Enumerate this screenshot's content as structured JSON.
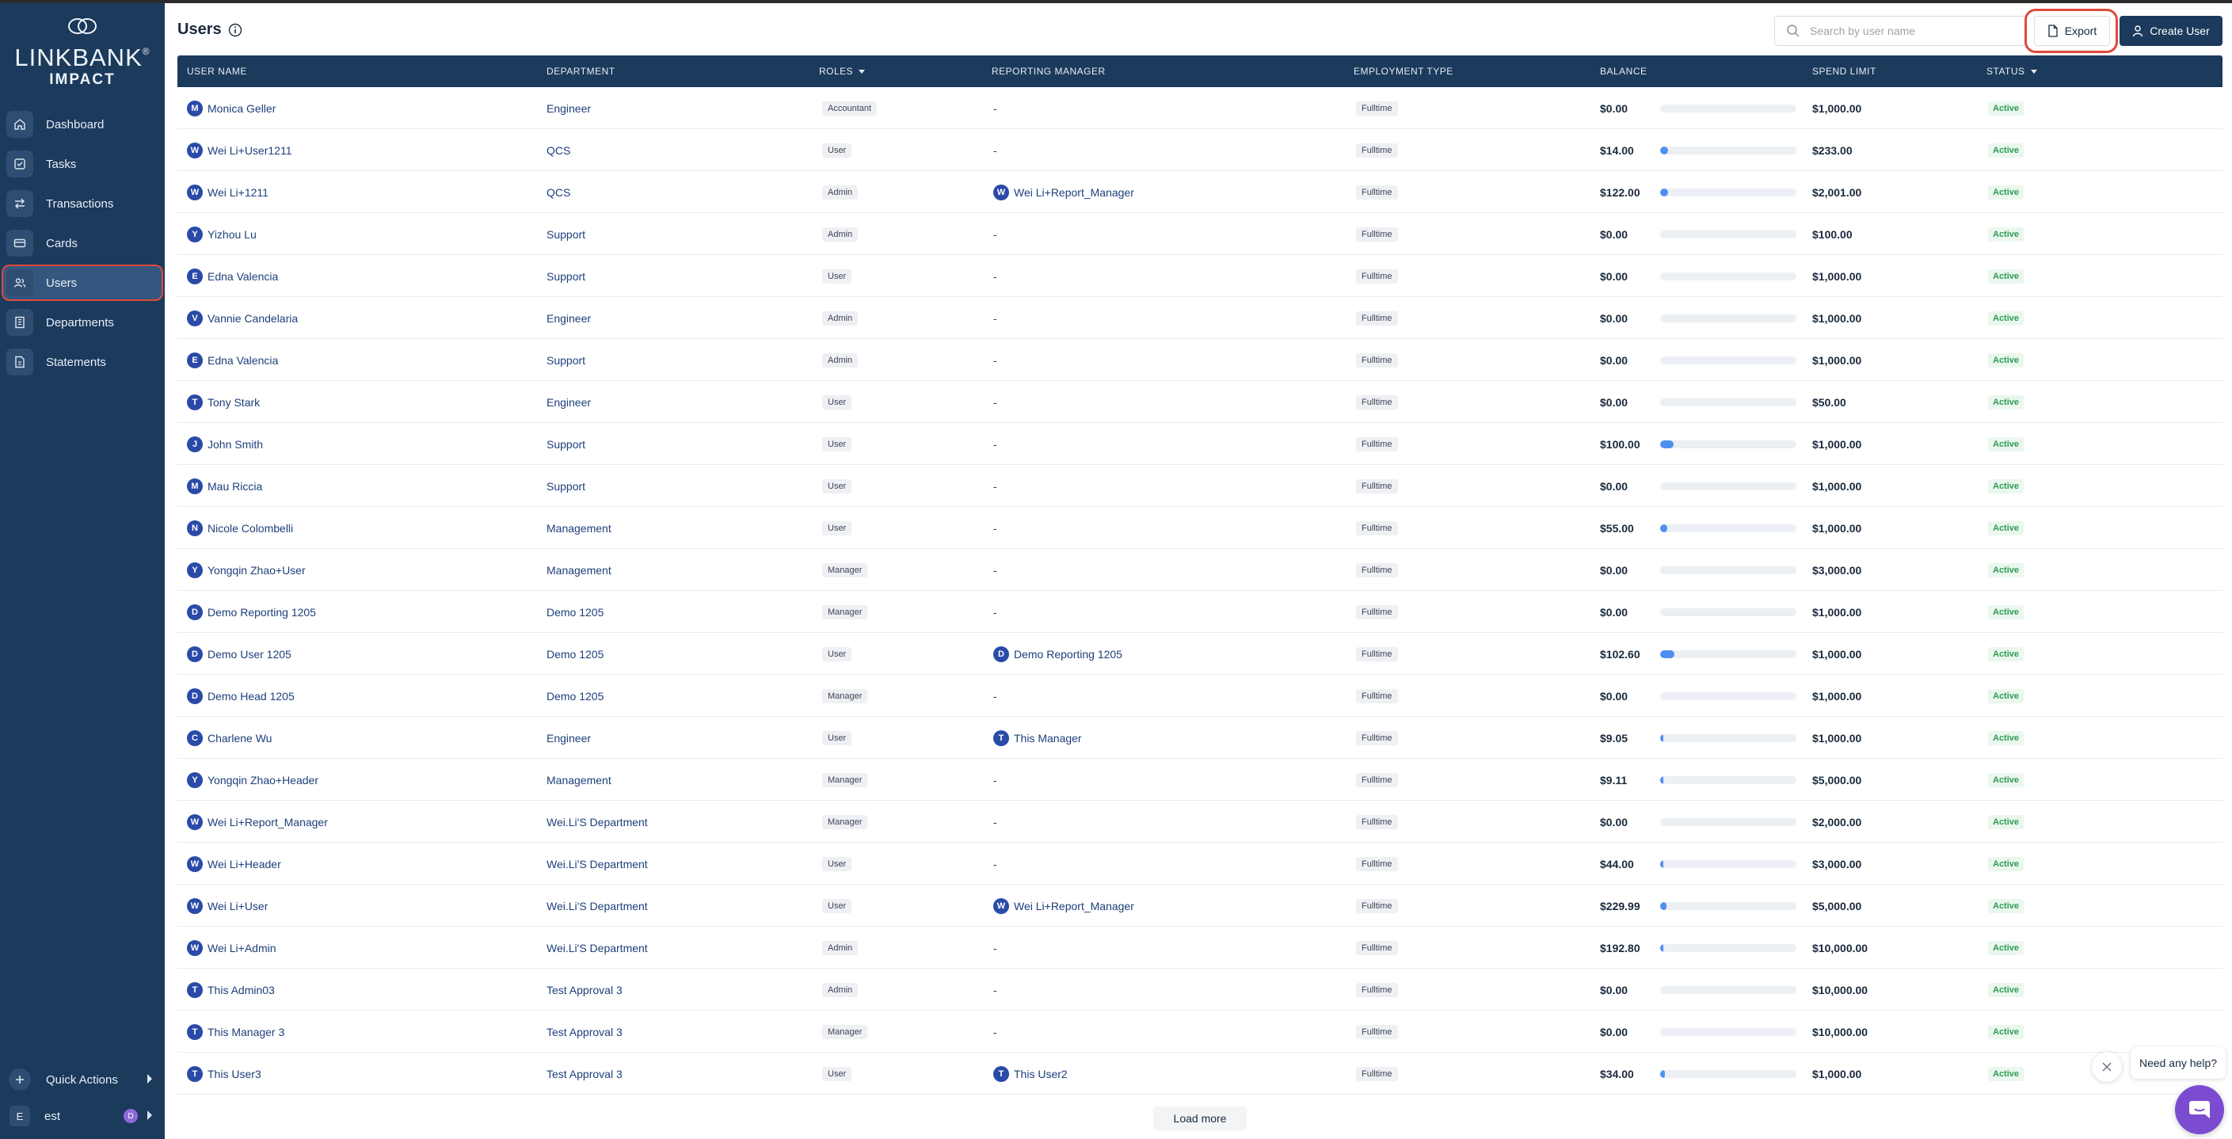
{
  "app": {
    "brand": "LINKBANK",
    "brand_mark": "®",
    "brand_sub": "IMPACT"
  },
  "sidebar": {
    "items": [
      {
        "label": "Dashboard",
        "icon": "home-icon"
      },
      {
        "label": "Tasks",
        "icon": "check-square-icon"
      },
      {
        "label": "Transactions",
        "icon": "arrows-icon"
      },
      {
        "label": "Cards",
        "icon": "card-icon"
      },
      {
        "label": "Users",
        "icon": "users-icon",
        "active": true
      },
      {
        "label": "Departments",
        "icon": "building-icon"
      },
      {
        "label": "Statements",
        "icon": "document-icon"
      }
    ],
    "quick_actions": "Quick Actions",
    "account_initial": "E",
    "account_name": "est",
    "account_avatar": "D"
  },
  "header": {
    "title": "Users",
    "search_placeholder": "Search by user name",
    "export_label": "Export",
    "create_label": "Create User"
  },
  "table": {
    "columns": [
      "USER NAME",
      "DEPARTMENT",
      "ROLES",
      "REPORTING MANAGER",
      "EMPLOYMENT TYPE",
      "BALANCE",
      "SPEND LIMIT",
      "STATUS"
    ],
    "rows": [
      {
        "initial": "M",
        "name": "Monica Geller",
        "dept": "Engineer",
        "role": "Accountant",
        "mgr": "-",
        "mgr_initial": "",
        "emp": "Fulltime",
        "balance": "$0.00",
        "bar": 0,
        "limit": "$1,000.00",
        "status": "Active"
      },
      {
        "initial": "W",
        "name": "Wei Li+User1211",
        "dept": "QCS",
        "role": "User",
        "mgr": "-",
        "mgr_initial": "",
        "emp": "Fulltime",
        "balance": "$14.00",
        "bar": 0.06,
        "limit": "$233.00",
        "status": "Active"
      },
      {
        "initial": "W",
        "name": "Wei Li+1211",
        "dept": "QCS",
        "role": "Admin",
        "mgr": "Wei Li+Report_Manager",
        "mgr_initial": "W",
        "emp": "Fulltime",
        "balance": "$122.00",
        "bar": 0.06,
        "limit": "$2,001.00",
        "status": "Active"
      },
      {
        "initial": "Y",
        "name": "Yizhou Lu",
        "dept": "Support",
        "role": "Admin",
        "mgr": "-",
        "mgr_initial": "",
        "emp": "Fulltime",
        "balance": "$0.00",
        "bar": 0,
        "limit": "$100.00",
        "status": "Active"
      },
      {
        "initial": "E",
        "name": "Edna Valencia",
        "dept": "Support",
        "role": "User",
        "mgr": "-",
        "mgr_initial": "",
        "emp": "Fulltime",
        "balance": "$0.00",
        "bar": 0,
        "limit": "$1,000.00",
        "status": "Active"
      },
      {
        "initial": "V",
        "name": "Vannie Candelaria",
        "dept": "Engineer",
        "role": "Admin",
        "mgr": "-",
        "mgr_initial": "",
        "emp": "Fulltime",
        "balance": "$0.00",
        "bar": 0,
        "limit": "$1,000.00",
        "status": "Active"
      },
      {
        "initial": "E",
        "name": "Edna Valencia",
        "dept": "Support",
        "role": "Admin",
        "mgr": "-",
        "mgr_initial": "",
        "emp": "Fulltime",
        "balance": "$0.00",
        "bar": 0,
        "limit": "$1,000.00",
        "status": "Active"
      },
      {
        "initial": "T",
        "name": "Tony Stark",
        "dept": "Engineer",
        "role": "User",
        "mgr": "-",
        "mgr_initial": "",
        "emp": "Fulltime",
        "balance": "$0.00",
        "bar": 0,
        "limit": "$50.00",
        "status": "Active"
      },
      {
        "initial": "J",
        "name": "John Smith",
        "dept": "Support",
        "role": "User",
        "mgr": "-",
        "mgr_initial": "",
        "emp": "Fulltime",
        "balance": "$100.00",
        "bar": 0.1,
        "limit": "$1,000.00",
        "status": "Active"
      },
      {
        "initial": "M",
        "name": "Mau Riccia",
        "dept": "Support",
        "role": "User",
        "mgr": "-",
        "mgr_initial": "",
        "emp": "Fulltime",
        "balance": "$0.00",
        "bar": 0,
        "limit": "$1,000.00",
        "status": "Active"
      },
      {
        "initial": "N",
        "name": "Nicole Colombelli",
        "dept": "Management",
        "role": "User",
        "mgr": "-",
        "mgr_initial": "",
        "emp": "Fulltime",
        "balance": "$55.00",
        "bar": 0.055,
        "limit": "$1,000.00",
        "status": "Active"
      },
      {
        "initial": "Y",
        "name": "Yongqin Zhao+User",
        "dept": "Management",
        "role": "Manager",
        "mgr": "-",
        "mgr_initial": "",
        "emp": "Fulltime",
        "balance": "$0.00",
        "bar": 0,
        "limit": "$3,000.00",
        "status": "Active"
      },
      {
        "initial": "D",
        "name": "Demo Reporting 1205",
        "dept": "Demo 1205",
        "role": "Manager",
        "mgr": "-",
        "mgr_initial": "",
        "emp": "Fulltime",
        "balance": "$0.00",
        "bar": 0,
        "limit": "$1,000.00",
        "status": "Active"
      },
      {
        "initial": "D",
        "name": "Demo User 1205",
        "dept": "Demo 1205",
        "role": "User",
        "mgr": "Demo Reporting 1205",
        "mgr_initial": "D",
        "emp": "Fulltime",
        "balance": "$102.60",
        "bar": 0.103,
        "limit": "$1,000.00",
        "status": "Active"
      },
      {
        "initial": "D",
        "name": "Demo Head 1205",
        "dept": "Demo 1205",
        "role": "Manager",
        "mgr": "-",
        "mgr_initial": "",
        "emp": "Fulltime",
        "balance": "$0.00",
        "bar": 0,
        "limit": "$1,000.00",
        "status": "Active"
      },
      {
        "initial": "C",
        "name": "Charlene Wu",
        "dept": "Engineer",
        "role": "User",
        "mgr": "This Manager",
        "mgr_initial": "T",
        "emp": "Fulltime",
        "balance": "$9.05",
        "bar": 0.009,
        "limit": "$1,000.00",
        "status": "Active"
      },
      {
        "initial": "Y",
        "name": "Yongqin Zhao+Header",
        "dept": "Management",
        "role": "Manager",
        "mgr": "-",
        "mgr_initial": "",
        "emp": "Fulltime",
        "balance": "$9.11",
        "bar": 0.002,
        "limit": "$5,000.00",
        "status": "Active"
      },
      {
        "initial": "W",
        "name": "Wei Li+Report_Manager",
        "dept": "Wei.Li'S Department",
        "role": "Manager",
        "mgr": "-",
        "mgr_initial": "",
        "emp": "Fulltime",
        "balance": "$0.00",
        "bar": 0,
        "limit": "$2,000.00",
        "status": "Active"
      },
      {
        "initial": "W",
        "name": "Wei Li+Header",
        "dept": "Wei.Li'S Department",
        "role": "User",
        "mgr": "-",
        "mgr_initial": "",
        "emp": "Fulltime",
        "balance": "$44.00",
        "bar": 0.015,
        "limit": "$3,000.00",
        "status": "Active"
      },
      {
        "initial": "W",
        "name": "Wei Li+User",
        "dept": "Wei.Li'S Department",
        "role": "User",
        "mgr": "Wei Li+Report_Manager",
        "mgr_initial": "W",
        "emp": "Fulltime",
        "balance": "$229.99",
        "bar": 0.046,
        "limit": "$5,000.00",
        "status": "Active"
      },
      {
        "initial": "W",
        "name": "Wei Li+Admin",
        "dept": "Wei.Li'S Department",
        "role": "Admin",
        "mgr": "-",
        "mgr_initial": "",
        "emp": "Fulltime",
        "balance": "$192.80",
        "bar": 0.019,
        "limit": "$10,000.00",
        "status": "Active"
      },
      {
        "initial": "T",
        "name": "This Admin03",
        "dept": "Test Approval 3",
        "role": "Admin",
        "mgr": "-",
        "mgr_initial": "",
        "emp": "Fulltime",
        "balance": "$0.00",
        "bar": 0,
        "limit": "$10,000.00",
        "status": "Active"
      },
      {
        "initial": "T",
        "name": "This Manager 3",
        "dept": "Test Approval 3",
        "role": "Manager",
        "mgr": "-",
        "mgr_initial": "",
        "emp": "Fulltime",
        "balance": "$0.00",
        "bar": 0,
        "limit": "$10,000.00",
        "status": "Active"
      },
      {
        "initial": "T",
        "name": "This User3",
        "dept": "Test Approval 3",
        "role": "User",
        "mgr": "This User2",
        "mgr_initial": "T",
        "emp": "Fulltime",
        "balance": "$34.00",
        "bar": 0.034,
        "limit": "$1,000.00",
        "status": "Active"
      }
    ],
    "load_more": "Load more"
  },
  "help": {
    "label": "Need any help?"
  },
  "colors": {
    "sidebar": "#1b3a5c",
    "accent": "#2a4aa8",
    "active_status": "#2f9b54",
    "highlight": "#e04a3a",
    "help_button": "#7b4ccf"
  }
}
